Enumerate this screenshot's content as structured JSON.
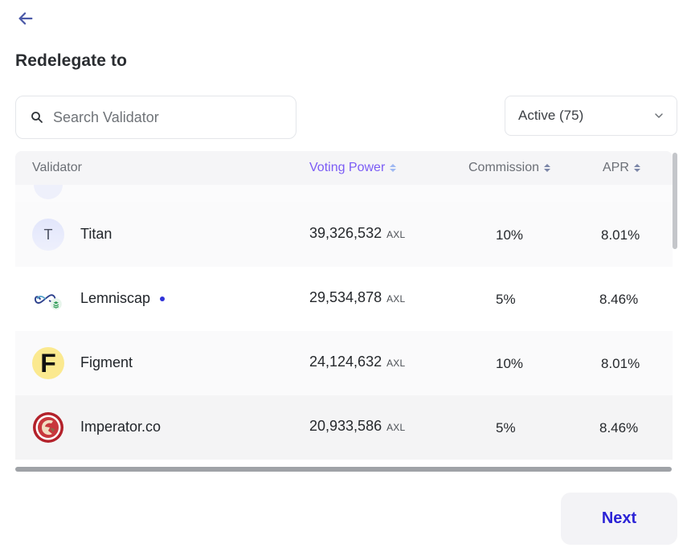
{
  "header": {
    "title": "Redelegate to"
  },
  "search": {
    "placeholder": "Search Validator",
    "value": ""
  },
  "filter": {
    "selected": "Active (75)"
  },
  "table": {
    "columns": {
      "validator": "Validator",
      "voting_power": "Voting Power",
      "commission": "Commission",
      "apr": "APR"
    },
    "active_sort_column": "voting_power",
    "rows": [
      {
        "name": "Titan",
        "avatar_letter": "T",
        "voting_power": "39,326,532",
        "unit": "AXL",
        "commission": "10%",
        "apr": "8.01%",
        "selected": false
      },
      {
        "name": "Lemniscap",
        "avatar_icon": "lemniscap-logo-icon",
        "voting_power": "29,534,878",
        "unit": "AXL",
        "commission": "5%",
        "apr": "8.46%",
        "selected": true
      },
      {
        "name": "Figment",
        "avatar_letter": "F",
        "voting_power": "24,124,632",
        "unit": "AXL",
        "commission": "10%",
        "apr": "8.01%",
        "selected": false
      },
      {
        "name": "Imperator.co",
        "avatar_icon": "imperator-logo-icon",
        "voting_power": "20,933,586",
        "unit": "AXL",
        "commission": "5%",
        "apr": "8.46%",
        "selected": false
      }
    ]
  },
  "footer": {
    "next_label": "Next"
  },
  "colors": {
    "accent": "#2b23d6",
    "sort_active": "#7b5cf5",
    "selected_dot": "#2f32d8"
  }
}
